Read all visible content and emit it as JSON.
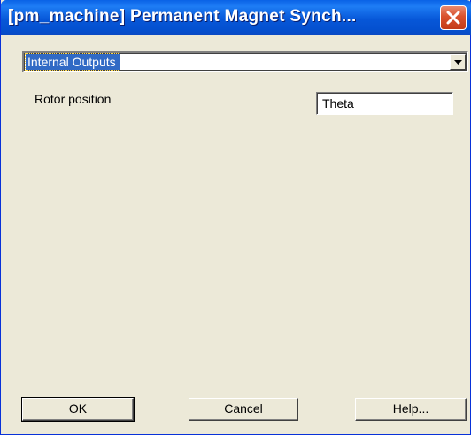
{
  "window": {
    "title": "[pm_machine] Permanent Magnet Synch..."
  },
  "dropdown": {
    "selected": "Internal Outputs"
  },
  "field": {
    "label": "Rotor position",
    "value": "Theta"
  },
  "buttons": {
    "ok": "OK",
    "cancel": "Cancel",
    "help": "Help..."
  },
  "icons": {
    "close": "close-icon",
    "dropdown_arrow": "chevron-down-icon"
  },
  "colors": {
    "titlebar": "#0757d8",
    "close_button": "#d9512d",
    "dialog_bg": "#ece9d8",
    "selection": "#316ac5"
  }
}
